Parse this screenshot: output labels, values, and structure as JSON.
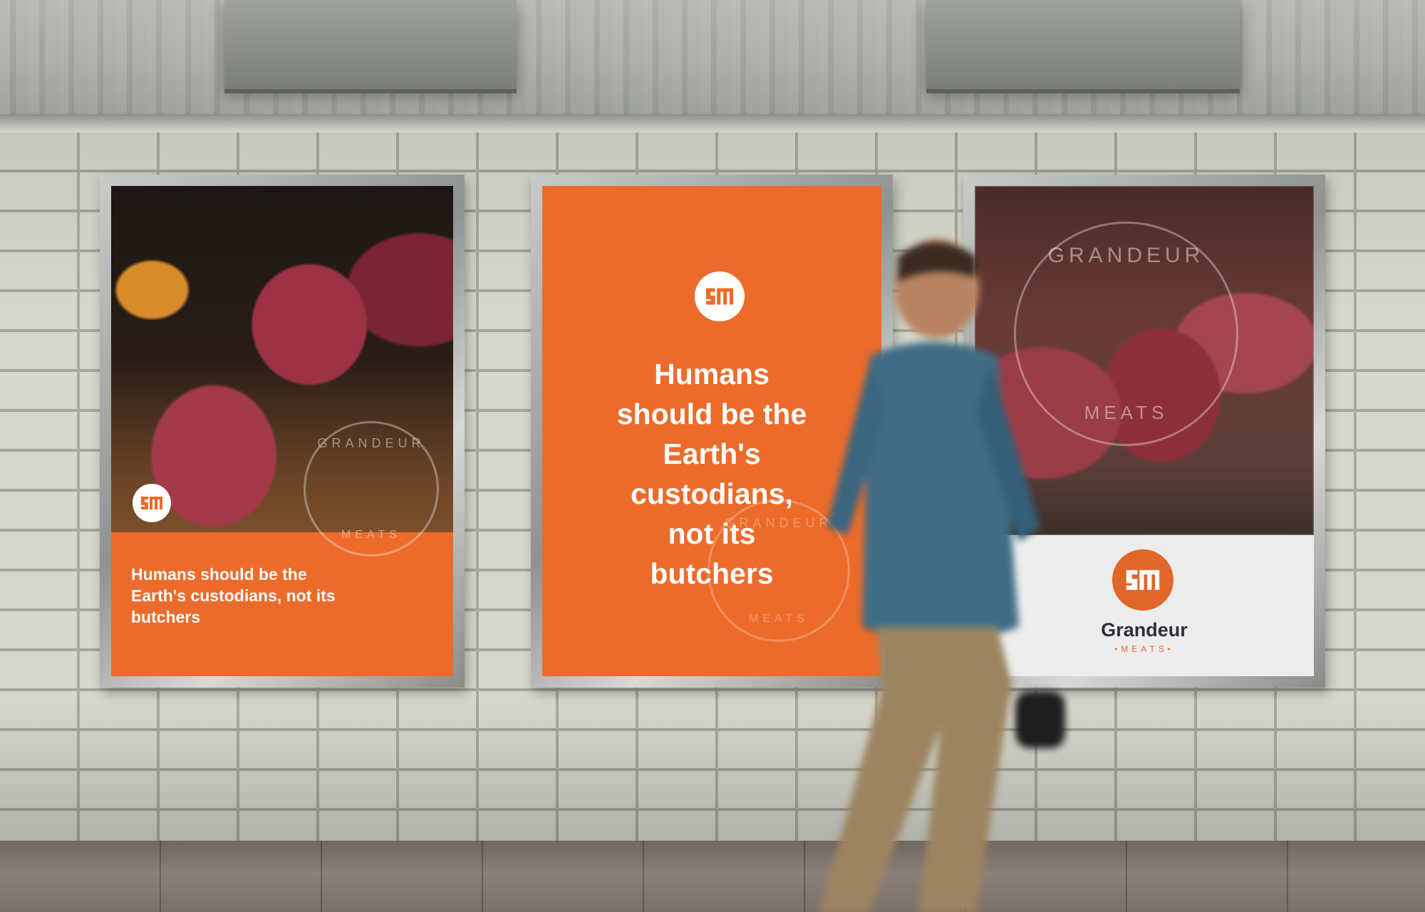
{
  "posters": [
    {
      "headline": "Humans should be the Earth's custodians, not its butchers",
      "seal_top": "GRANDEUR",
      "seal_bottom": "MEATS"
    },
    {
      "headline": "Humans should be the Earth's custodians, not its butchers",
      "seal_top": "GRANDEUR",
      "seal_bottom": "MEATS"
    },
    {
      "brand_name": "Grandeur",
      "brand_sub": "•MEATS•",
      "seal_top": "GRANDEUR",
      "seal_bottom": "MEATS"
    }
  ],
  "colors": {
    "brand_orange": "#ec6b2a",
    "brand_text": "#2b2f36",
    "poster_white": "#ededee"
  },
  "icons": [
    "grandeur-meats-logo-icon",
    "grandeur-meats-seal"
  ]
}
